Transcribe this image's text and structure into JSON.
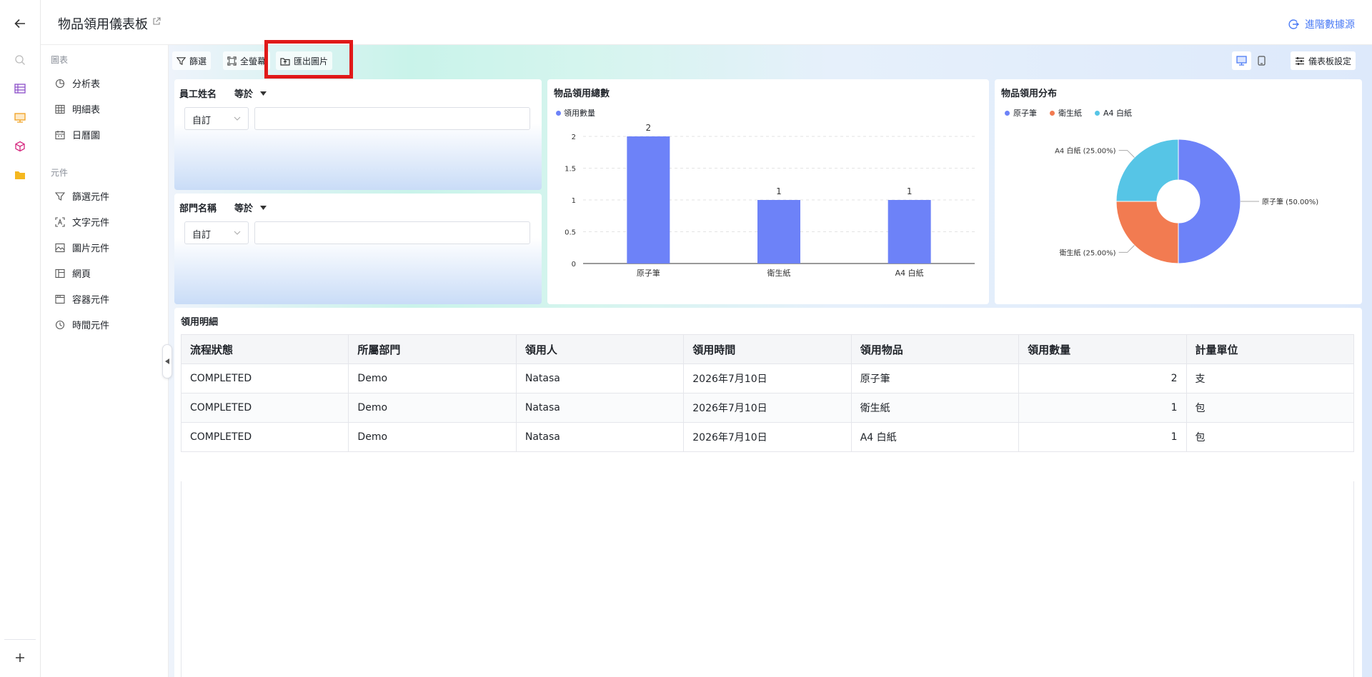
{
  "header": {
    "title": "物品領用儀表板",
    "advanced_data_label": "進階數據源"
  },
  "rail": {
    "icons": [
      "back-arrow-icon",
      "search-icon",
      "table-icon",
      "dashboard-icon",
      "cube-icon",
      "folder-icon",
      "plus-icon"
    ]
  },
  "panel": {
    "charts_section": "圖表",
    "chart_items": [
      "分析表",
      "明細表",
      "日曆圖"
    ],
    "components_section": "元件",
    "component_items": [
      "篩選元件",
      "文字元件",
      "圖片元件",
      "網頁",
      "容器元件",
      "時間元件"
    ]
  },
  "toolbar": {
    "filter_label": "篩選",
    "fullscreen_label": "全螢幕",
    "export_label": "匯出圖片",
    "settings_label": "儀表板設定"
  },
  "filters": [
    {
      "field": "員工姓名",
      "operator": "等於",
      "mode": "自訂",
      "value": ""
    },
    {
      "field": "部門名稱",
      "operator": "等於",
      "mode": "自訂",
      "value": ""
    }
  ],
  "bar_card": {
    "title": "物品領用總數"
  },
  "pie_card": {
    "title": "物品領用分布"
  },
  "chart_data": [
    {
      "type": "bar",
      "title": "物品領用總數",
      "categories": [
        "原子筆",
        "衛生紙",
        "A4 白紙"
      ],
      "series": [
        {
          "name": "領用數量",
          "values": [
            2,
            1,
            1
          ],
          "color": "#6d82f8"
        }
      ],
      "yticks": [
        "0",
        "0.5",
        "1",
        "1.5",
        "2"
      ],
      "ylim": [
        0,
        2
      ],
      "grid": true,
      "legend": "top-left"
    },
    {
      "type": "pie",
      "title": "物品領用分布",
      "labels": [
        "原子筆",
        "衛生紙",
        "A4 白紙"
      ],
      "values": [
        50,
        25,
        25
      ],
      "slice_labels": [
        "原子筆 (50.00%)",
        "衛生紙 (25.00%)",
        "A4 白紙 (25.00%)"
      ],
      "colors": [
        "#6d82f8",
        "#f27b51",
        "#56c5e6"
      ],
      "donut": true,
      "legend": "top-left"
    }
  ],
  "detail": {
    "title": "領用明細",
    "columns": [
      "流程狀態",
      "所屬部門",
      "領用人",
      "領用時間",
      "領用物品",
      "領用數量",
      "計量單位"
    ],
    "rows": [
      [
        "COMPLETED",
        "Demo",
        "Natasa",
        "2026年7月10日",
        "原子筆",
        "2",
        "支"
      ],
      [
        "COMPLETED",
        "Demo",
        "Natasa",
        "2026年7月10日",
        "衛生紙",
        "1",
        "包"
      ],
      [
        "COMPLETED",
        "Demo",
        "Natasa",
        "2026年7月10日",
        "A4 白紙",
        "1",
        "包"
      ]
    ]
  },
  "colors": {
    "accent": "#4b7bf5",
    "highlight_box": "#e01919",
    "bar": "#6d82f8"
  }
}
